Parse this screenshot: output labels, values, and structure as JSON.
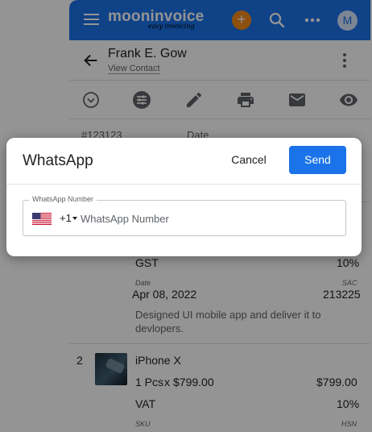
{
  "app": {
    "brand_name": "mooninvoice",
    "brand_tagline": "easy invoicing",
    "avatar_initial": "M",
    "colors": {
      "primary": "#1a73e8",
      "accent": "#f28b1b"
    }
  },
  "contact": {
    "name": "Frank E. Gow",
    "view_link": "View Contact"
  },
  "toolbar_icons": [
    "status-icon",
    "settings-sliders-icon",
    "edit-pencil-icon",
    "print-icon",
    "email-icon",
    "preview-eye-icon"
  ],
  "invoice": {
    "number": "#123123",
    "date_label": "Date",
    "item1": {
      "tax_name": "GST",
      "tax_rate": "10%",
      "date_label": "Date",
      "date": "Apr 08, 2022",
      "code_label": "SAC",
      "code": "213225",
      "description": "Designed UI mobile app and deliver it to devlopers."
    },
    "item2": {
      "index": "2",
      "name": "iPhone X",
      "qty": "1 Pcs",
      "times": "x",
      "unit_price": "$799.00",
      "amount": "$799.00",
      "tax_name": "VAT",
      "tax_rate": "10%",
      "sku_label": "SKU",
      "code_label": "HSN"
    }
  },
  "dialog": {
    "title": "WhatsApp",
    "cancel_label": "Cancel",
    "send_label": "Send",
    "field_label": "WhatsApp Number",
    "dial_code": "+1",
    "placeholder": "WhatsApp Number",
    "value": ""
  }
}
